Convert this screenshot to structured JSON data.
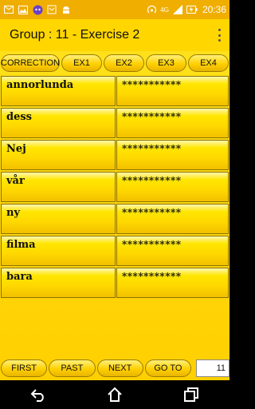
{
  "status_bar": {
    "time": "20:36",
    "network": "4G",
    "left_icons": [
      "mail-icon",
      "image-icon",
      "game-controller-icon",
      "android-debug-icon",
      "android-icon"
    ],
    "right_icons": [
      "hotspot-icon",
      "signal-icon",
      "battery-charging-icon"
    ]
  },
  "app_bar": {
    "title": "Group : 11 - Exercise 2",
    "menu_icon": "overflow-menu-icon"
  },
  "tabs": [
    {
      "label": "CORRECTION"
    },
    {
      "label": "EX1"
    },
    {
      "label": "EX2"
    },
    {
      "label": "EX3"
    },
    {
      "label": "EX4"
    }
  ],
  "rows": [
    {
      "word": "annorlunda",
      "mask": "***********"
    },
    {
      "word": "dess",
      "mask": "***********"
    },
    {
      "word": "Nej",
      "mask": "***********"
    },
    {
      "word": "vår",
      "mask": "***********"
    },
    {
      "word": "ny",
      "mask": "***********"
    },
    {
      "word": "filma",
      "mask": "***********"
    },
    {
      "word": "bara",
      "mask": "***********"
    }
  ],
  "bottom_nav": {
    "first": "FIRST",
    "past": "PAST",
    "next": "NEXT",
    "goto": "GO TO",
    "goto_value": "11"
  },
  "colors": {
    "status_bar": "#f0ae00",
    "app_bar": "#ffd600",
    "content": "#ffd800"
  }
}
